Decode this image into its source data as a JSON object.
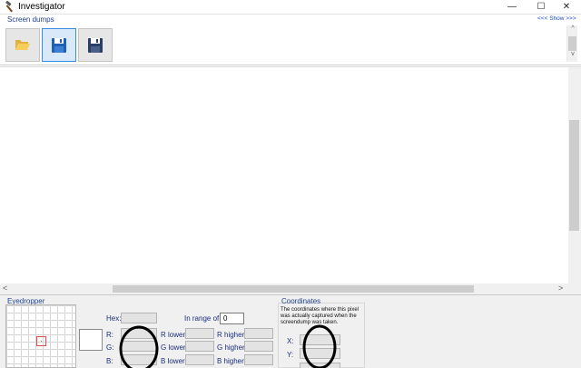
{
  "window": {
    "title": "Investigator",
    "minimize_glyph": "—",
    "maximize_glyph": "☐",
    "close_glyph": "✕"
  },
  "screen_dumps": {
    "label": "Screen dumps",
    "show_link": "<<< Show >>>",
    "toolbar": [
      {
        "icon": "folder-open-icon"
      },
      {
        "icon": "save-icon"
      },
      {
        "icon": "save-as-icon"
      }
    ]
  },
  "scrollbars": {
    "up_glyph": "^",
    "down_glyph": "v",
    "left_glyph": "<",
    "right_glyph": ">"
  },
  "eyedropper": {
    "label": "Eyedropper",
    "hex_label": "Hex:",
    "in_range_label": "In range of:",
    "in_range_value": "0",
    "r_label": "R:",
    "g_label": "G:",
    "b_label": "B:",
    "r_lower_label": "R lower:",
    "g_lower_label": "G lower:",
    "b_lower_label": "B lower:",
    "r_higher_label": "R higher:",
    "g_higher_label": "G higher:",
    "b_higher_label": "B higher:"
  },
  "coordinates": {
    "label": "Coordinates",
    "description": "The coordinates where this pixel was actually captured when the screendump was taken.",
    "x_label": "X:",
    "y_label": "Y:"
  },
  "colors": {
    "accent": "#3a8ee0",
    "label_blue": "#1f3f8f",
    "annotation": "#000000"
  }
}
